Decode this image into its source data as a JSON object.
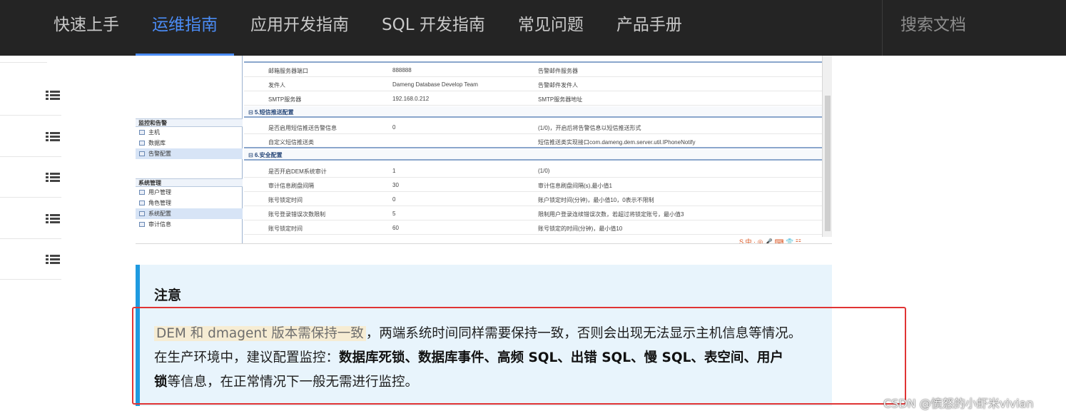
{
  "nav": {
    "items": [
      "快速上手",
      "运维指南",
      "应用开发指南",
      "SQL 开发指南",
      "常见问题",
      "产品手册"
    ],
    "active_index": 1,
    "search_placeholder": "搜索文档"
  },
  "sidebar": {
    "item_count": 5,
    "icon": "list-icon"
  },
  "screenshot": {
    "tree_groups": [
      {
        "title": "监控和告警",
        "items": [
          {
            "label": "主机",
            "icon": "host-icon",
            "selected": false
          },
          {
            "label": "数据库",
            "icon": "database-icon",
            "selected": false
          },
          {
            "label": "告警配置",
            "icon": "alarm-icon",
            "selected": true
          }
        ]
      },
      {
        "title": "系统管理",
        "items": [
          {
            "label": "用户管理",
            "icon": "user-icon",
            "selected": false
          },
          {
            "label": "角色管理",
            "icon": "role-icon",
            "selected": false
          },
          {
            "label": "系统配置",
            "icon": "tools-icon",
            "selected": true
          },
          {
            "label": "审计信息",
            "icon": "audit-icon",
            "selected": false
          }
        ]
      }
    ],
    "rows_top": [
      {
        "name": "邮箱服务器端口",
        "value": "888888",
        "desc": "告警邮件服务器"
      },
      {
        "name": "发件人",
        "value": "Dameng Database Develop Team",
        "desc": "告警邮件发件人"
      },
      {
        "name": "SMTP服务器",
        "value": "192.168.0.212",
        "desc": "SMTP服务器地址"
      }
    ],
    "section_sms": "⊟ 5.短信推送配置",
    "rows_sms": [
      {
        "name": "是否启用短信推送告警信息",
        "value": "0",
        "desc": "(1/0)，开启后将告警信息以短信推送形式"
      },
      {
        "name": "自定义短信推送类",
        "value": "",
        "desc": "短信推送类实现接口com.dameng.dem.server.util.IPhoneNotify"
      }
    ],
    "section_security": "⊟ 6.安全配置",
    "rows_security": [
      {
        "name": "是否开启DEM系统审计",
        "value": "1",
        "desc": "(1/0)"
      },
      {
        "name": "审计信息刷盘间隔",
        "value": "30",
        "desc": "审计信息刷盘间隔(s),最小值1"
      },
      {
        "name": "账号锁定时间",
        "value": "0",
        "desc": "账户锁定时间(分钟)，最小值10，0表示不限制"
      },
      {
        "name": "账号登录错误次数限制",
        "value": "5",
        "desc": "限制用户登录连续错误次数，若超过将锁定账号，最小值3"
      },
      {
        "name": "账号锁定时间",
        "value": "60",
        "desc": "账号锁定的时间(分钟)，最小值10"
      }
    ],
    "footer": "S 中 ·,◎ 🎤 ⌨ 👕 ☷"
  },
  "note": {
    "title": "注意",
    "highlight": "DEM 和 dmagent 版本需保持一致",
    "line1_rest": "，两端系统时间同样需要保持一致，否则会出现无法显示主机信息等情况。",
    "line2_prefix": "在生产环境中，建议配置监控：",
    "line2_bold": "数据库死锁、数据库事件、高频 SQL、出错 SQL、慢 SQL、表空间、用户",
    "line3_bold": "锁",
    "line3_rest": "等信息，在正常情况下一般无需进行监控。"
  },
  "watermark": "CSDN @愤怒的小虾米vivian",
  "colors": {
    "nav_bg": "#242424",
    "nav_active": "#4b8cf5",
    "note_bg": "#e8f4fc",
    "note_border": "#1f9ae0",
    "red_frame": "#e03434"
  }
}
